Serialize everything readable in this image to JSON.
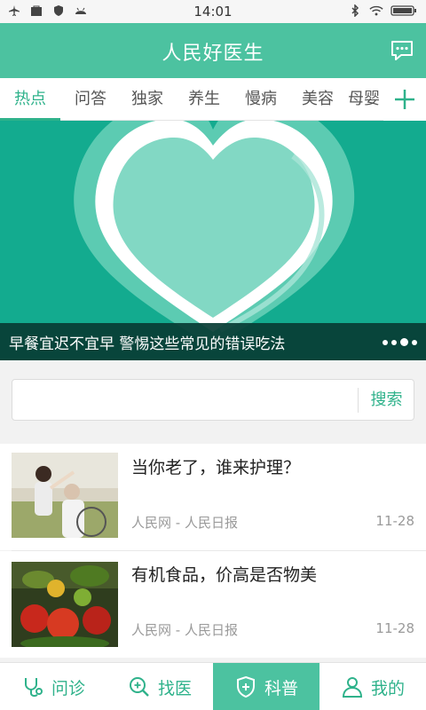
{
  "status_bar": {
    "time": "14:01"
  },
  "header": {
    "title": "人民好医生",
    "message_icon": "chat-bubble-icon"
  },
  "tabs": [
    {
      "label": "热点",
      "active": true
    },
    {
      "label": "问答",
      "active": false
    },
    {
      "label": "独家",
      "active": false
    },
    {
      "label": "养生",
      "active": false
    },
    {
      "label": "慢病",
      "active": false
    },
    {
      "label": "美容",
      "active": false
    },
    {
      "label": "母婴",
      "active": false
    }
  ],
  "banner": {
    "caption": "早餐宜迟不宜早 警惕这些常见的错误吃法",
    "slide_count": 4,
    "active_slide": 3
  },
  "search": {
    "value": "",
    "button_label": "搜索"
  },
  "news": [
    {
      "title": "当你老了，谁来护理？",
      "source": "人民网 - 人民日报",
      "date": "11-28"
    },
    {
      "title": "有机食品，价高是否物美",
      "source": "人民网 - 人民日报",
      "date": "11-28"
    }
  ],
  "bottom_nav": [
    {
      "label": "问诊",
      "icon": "stethoscope-icon",
      "active": false
    },
    {
      "label": "找医",
      "icon": "search-doctor-icon",
      "active": false
    },
    {
      "label": "科普",
      "icon": "shield-plus-icon",
      "active": true
    },
    {
      "label": "我的",
      "icon": "user-icon",
      "active": false
    }
  ],
  "colors": {
    "primary": "#4cc2a0",
    "accent": "#2fb28b",
    "banner_bg": "#13ab8f"
  }
}
